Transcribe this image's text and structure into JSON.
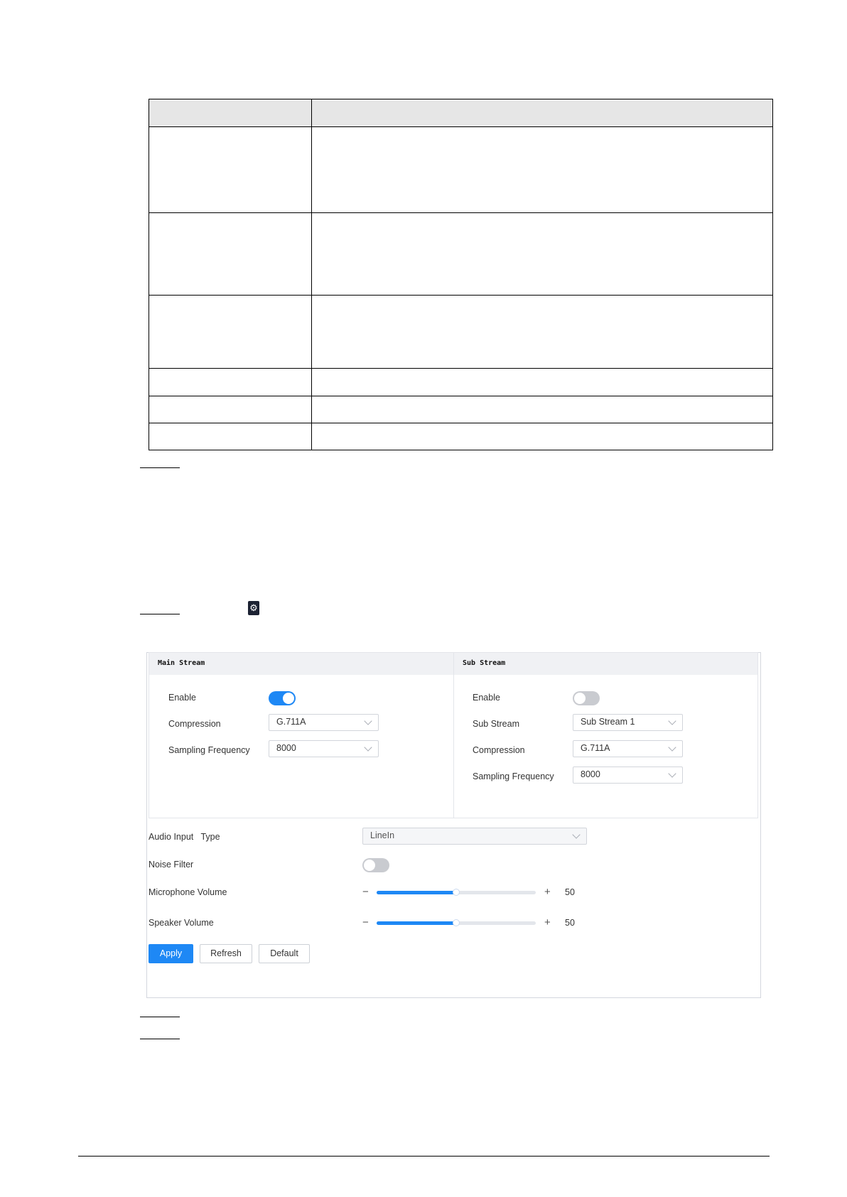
{
  "main_stream": {
    "title": "Main Stream",
    "enable_label": "Enable",
    "enable_on": true,
    "compression_label": "Compression",
    "compression_value": "G.711A",
    "sampling_label": "Sampling Frequency",
    "sampling_value": "8000"
  },
  "sub_stream": {
    "title": "Sub Stream",
    "enable_label": "Enable",
    "enable_on": false,
    "sub_stream_label": "Sub Stream",
    "sub_stream_value": "Sub Stream 1",
    "compression_label": "Compression",
    "compression_value": "G.711A",
    "sampling_label": "Sampling Frequency",
    "sampling_value": "8000"
  },
  "audio_input": {
    "label": "Audio Input   Type",
    "value": "LineIn"
  },
  "noise_filter": {
    "label": "Noise Filter",
    "on": false
  },
  "microphone_volume": {
    "label": "Microphone Volume",
    "value": "50",
    "level": 0.5
  },
  "speaker_volume": {
    "label": "Speaker Volume",
    "value": "50",
    "level": 0.5
  },
  "buttons": {
    "apply": "Apply",
    "refresh": "Refresh",
    "default": "Default"
  },
  "colors": {
    "accent": "#1e88f5",
    "toggle_off": "#c9cbd0",
    "header_bg": "#f0f1f4"
  },
  "icons": {
    "settings_button": "gear-icon",
    "minus": "−",
    "plus": "+"
  }
}
